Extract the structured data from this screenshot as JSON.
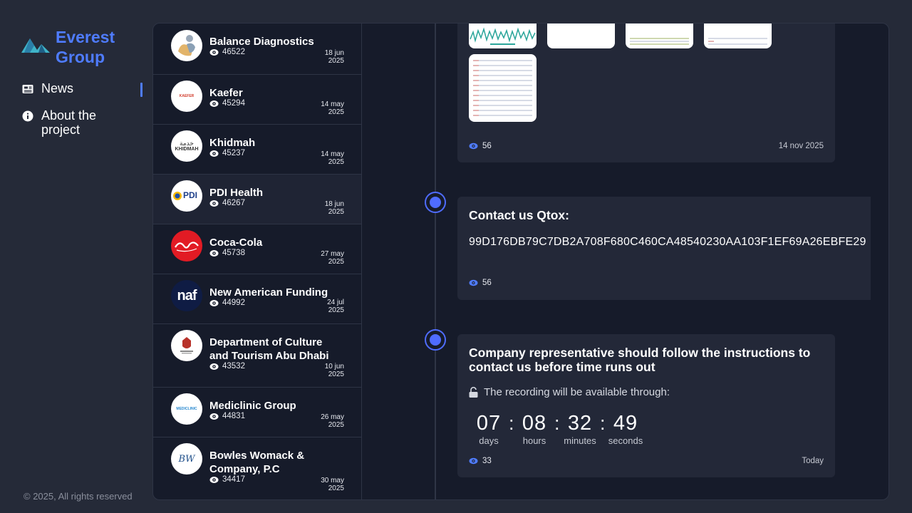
{
  "brand": {
    "line1": "Everest",
    "line2": "Group"
  },
  "nav": {
    "news": "News",
    "about": "About the project"
  },
  "footer": "© 2025, All rights reserved",
  "companies": [
    {
      "name": "Balance Diagnostics",
      "views": "46522",
      "date_day": "18 jun",
      "date_year": "2025",
      "logo": "balance-diagnostics-logo"
    },
    {
      "name": "Kaefer",
      "views": "45294",
      "date_day": "14 may",
      "date_year": "2025",
      "logo": "kaefer-logo"
    },
    {
      "name": "Khidmah",
      "views": "45237",
      "date_day": "14 may",
      "date_year": "2025",
      "logo": "khidmah-logo"
    },
    {
      "name": "PDI Health",
      "views": "46267",
      "date_day": "18 jun",
      "date_year": "2025",
      "logo": "pdi-logo"
    },
    {
      "name": "Coca-Cola",
      "views": "45738",
      "date_day": "27 may",
      "date_year": "2025",
      "logo": "coca-cola-logo"
    },
    {
      "name": "New American Funding",
      "views": "44992",
      "date_day": "24 jul",
      "date_year": "2025",
      "logo": "naf-logo"
    },
    {
      "name": "Department of Culture and Tourism Abu Dhabi",
      "views": "43532",
      "date_day": "10 jun",
      "date_year": "2025",
      "logo": "dct-abu-dhabi-logo"
    },
    {
      "name": "Mediclinic Group",
      "views": "44831",
      "date_day": "26 may",
      "date_year": "2025",
      "logo": "mediclinic-logo"
    },
    {
      "name": "Bowles Womack & Company, P.C",
      "views": "34417",
      "date_day": "30 may",
      "date_year": "2025",
      "logo": "bwc-logo"
    }
  ],
  "logo_text": {
    "kaefer": "KAEFER",
    "khidmah_ar": "خدمة",
    "khidmah_en": "KHIDMAH",
    "pdi": "PDI",
    "naf": "naf",
    "mediclinic": "MEDICLINIC",
    "bwc": "BW"
  },
  "cards": {
    "gallery": {
      "views": "56",
      "date": "14 nov 2025"
    },
    "contact": {
      "title": "Contact us Qtox:",
      "code": "99D176DB79C7DB2A708F680C460CA48540230AA103F1EF69A26EBFE29",
      "views": "56"
    },
    "countdown": {
      "title": "Company representative should follow the instructions to contact us before time runs out",
      "recording": "The recording will be available through:",
      "days": "07",
      "hours": "08",
      "minutes": "32",
      "seconds": "49",
      "days_label": "days",
      "hours_label": "hours",
      "minutes_label": "minutes",
      "seconds_label": "seconds",
      "separator": ":",
      "views": "33",
      "date": "Today"
    }
  },
  "colors": {
    "accent": "#4f7cff",
    "background": "#252a38",
    "panel": "#161b2a",
    "card": "#232838"
  }
}
